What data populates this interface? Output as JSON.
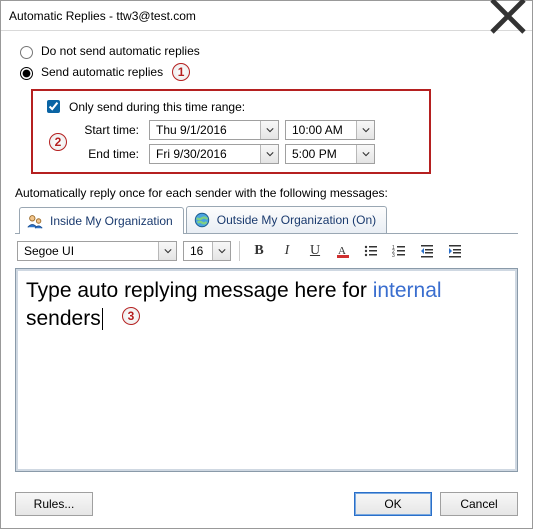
{
  "window": {
    "title": "Automatic Replies - ttw3@test.com"
  },
  "options": {
    "no_send_label": "Do not send automatic replies",
    "send_label": "Send automatic replies"
  },
  "callouts": {
    "c1": "1",
    "c2": "2",
    "c3": "3"
  },
  "timerange": {
    "check_label": "Only send during this time range:",
    "start_label": "Start time:",
    "end_label": "End time:",
    "start_date": "Thu 9/1/2016",
    "start_time": "10:00 AM",
    "end_date": "Fri 9/30/2016",
    "end_time": "5:00 PM"
  },
  "instruction": "Automatically reply once for each sender with the following messages:",
  "tabs": {
    "inside": "Inside My Organization",
    "outside": "Outside My Organization (On)"
  },
  "toolbar": {
    "font": "Segoe UI",
    "size": "16"
  },
  "editor": {
    "part1": "Type auto replying message here for ",
    "part2": "internal",
    "part3": "senders"
  },
  "footer": {
    "rules": "Rules...",
    "ok": "OK",
    "cancel": "Cancel"
  }
}
